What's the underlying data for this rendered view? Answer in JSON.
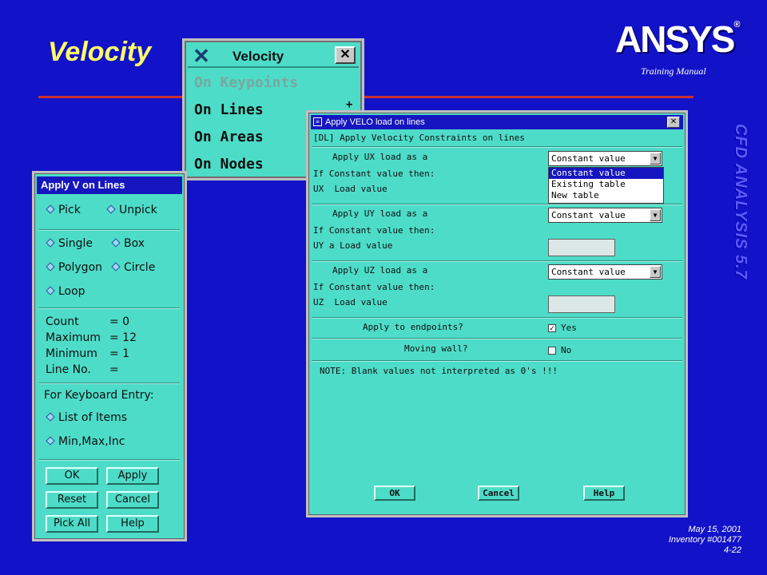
{
  "slide": {
    "title": "Velocity",
    "logo": "ANSYS",
    "logo_mark": "®",
    "subtitle": "Training Manual",
    "side_caption": "CFD ANALYSIS 5.7",
    "footer": {
      "date": "May 15, 2001",
      "inventory": "Inventory #001477",
      "page": "4-22"
    },
    "colors": {
      "background": "#1212c8",
      "title": "#ffff66",
      "rule": "#c83232",
      "panel": "#4ddcc8",
      "titlebar": "#1616c0"
    }
  },
  "velocity_menu": {
    "title": "Velocity",
    "close_label": "✕",
    "items": [
      {
        "label": "On Keypoints",
        "enabled": false
      },
      {
        "label": "On Lines",
        "enabled": true,
        "marker": "+"
      },
      {
        "label": "On Areas",
        "enabled": true
      },
      {
        "label": "On Nodes",
        "enabled": true
      }
    ]
  },
  "picker": {
    "title": "Apply V on Lines",
    "pick_mode": [
      "Pick",
      "Unpick"
    ],
    "shape_mode": [
      "Single",
      "Box",
      "Polygon",
      "Circle",
      "Loop"
    ],
    "counts": [
      {
        "label": "Count",
        "value": "= 0"
      },
      {
        "label": "Maximum",
        "value": "= 12"
      },
      {
        "label": "Minimum",
        "value": "= 1"
      },
      {
        "label": "Line No.",
        "value": "="
      }
    ],
    "keyboard_label": "For Keyboard Entry:",
    "entry_modes": [
      "List of Items",
      "Min,Max,Inc"
    ],
    "buttons": [
      "OK",
      "Apply",
      "Reset",
      "Cancel",
      "Pick All",
      "Help"
    ]
  },
  "dialog": {
    "title": "Apply VELO load on lines",
    "close_label": "✕",
    "heading": "[DL] Apply Velocity Constraints on lines",
    "ux": {
      "label": "Apply UX load as a",
      "if_label": "If Constant value then:",
      "value_label": "UX  Load value",
      "selected": "Constant value"
    },
    "uy": {
      "label": "Apply UY load as a",
      "if_label": "If Constant value then:",
      "value_label": "UY a Load value",
      "selected": "Constant value"
    },
    "uz": {
      "label": "Apply UZ load as a",
      "if_label": "If Constant value then:",
      "value_label": "UZ  Load value",
      "selected": "Constant value"
    },
    "dropdown_options": [
      "Constant value",
      "Existing table",
      "New table"
    ],
    "endpoints": {
      "label": "Apply to endpoints?",
      "value": "Yes",
      "checked": true
    },
    "moving_wall": {
      "label": "Moving wall?",
      "value": "No",
      "checked": false
    },
    "note": "NOTE: Blank values not interpreted as 0's !!!",
    "buttons": [
      "OK",
      "Cancel",
      "Help"
    ]
  }
}
